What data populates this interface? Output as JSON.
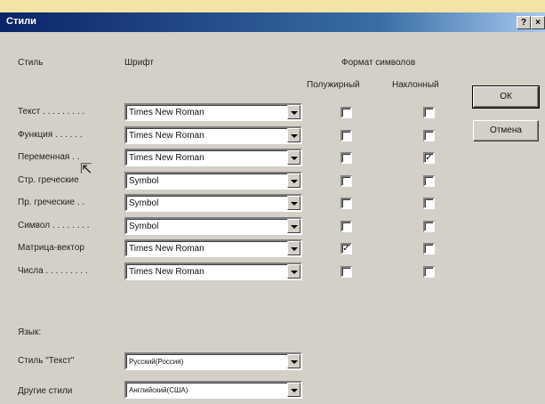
{
  "window": {
    "title": "Стили",
    "help_label": "?",
    "close_label": "×"
  },
  "headers": {
    "style": "Стиль",
    "font": "Шрифт",
    "format": "Формат символов",
    "bold": "Полужирный",
    "italic": "Наклонный"
  },
  "rows": [
    {
      "label": "Текст . . . . . . . . .",
      "font": "Times New Roman",
      "bold": false,
      "italic": false
    },
    {
      "label": "Функция . . . . . .",
      "font": "Times New Roman",
      "bold": false,
      "italic": false
    },
    {
      "label": "Переменная . .",
      "font": "Times New Roman",
      "bold": false,
      "italic": true
    },
    {
      "label": "Стр. греческие",
      "font": "Symbol",
      "bold": false,
      "italic": false
    },
    {
      "label": "Пр. греческие . .",
      "font": "Symbol",
      "bold": false,
      "italic": false
    },
    {
      "label": "Символ . . . . . . . .",
      "font": "Symbol",
      "bold": false,
      "italic": false
    },
    {
      "label": "Матрица-вектор",
      "font": "Times New Roman",
      "bold": true,
      "italic": false
    },
    {
      "label": "Числа . . . . . . . . .",
      "font": "Times New Roman",
      "bold": false,
      "italic": false
    }
  ],
  "language": {
    "label": "Язык:",
    "text_style_label": "Стиль \"Текст\"",
    "text_style_value": "Русский(Россия)",
    "other_styles_label": "Другие стили",
    "other_styles_value": "Английский(США)"
  },
  "buttons": {
    "ok": "ОК",
    "cancel": "Отмена"
  },
  "check_mark": "✓"
}
